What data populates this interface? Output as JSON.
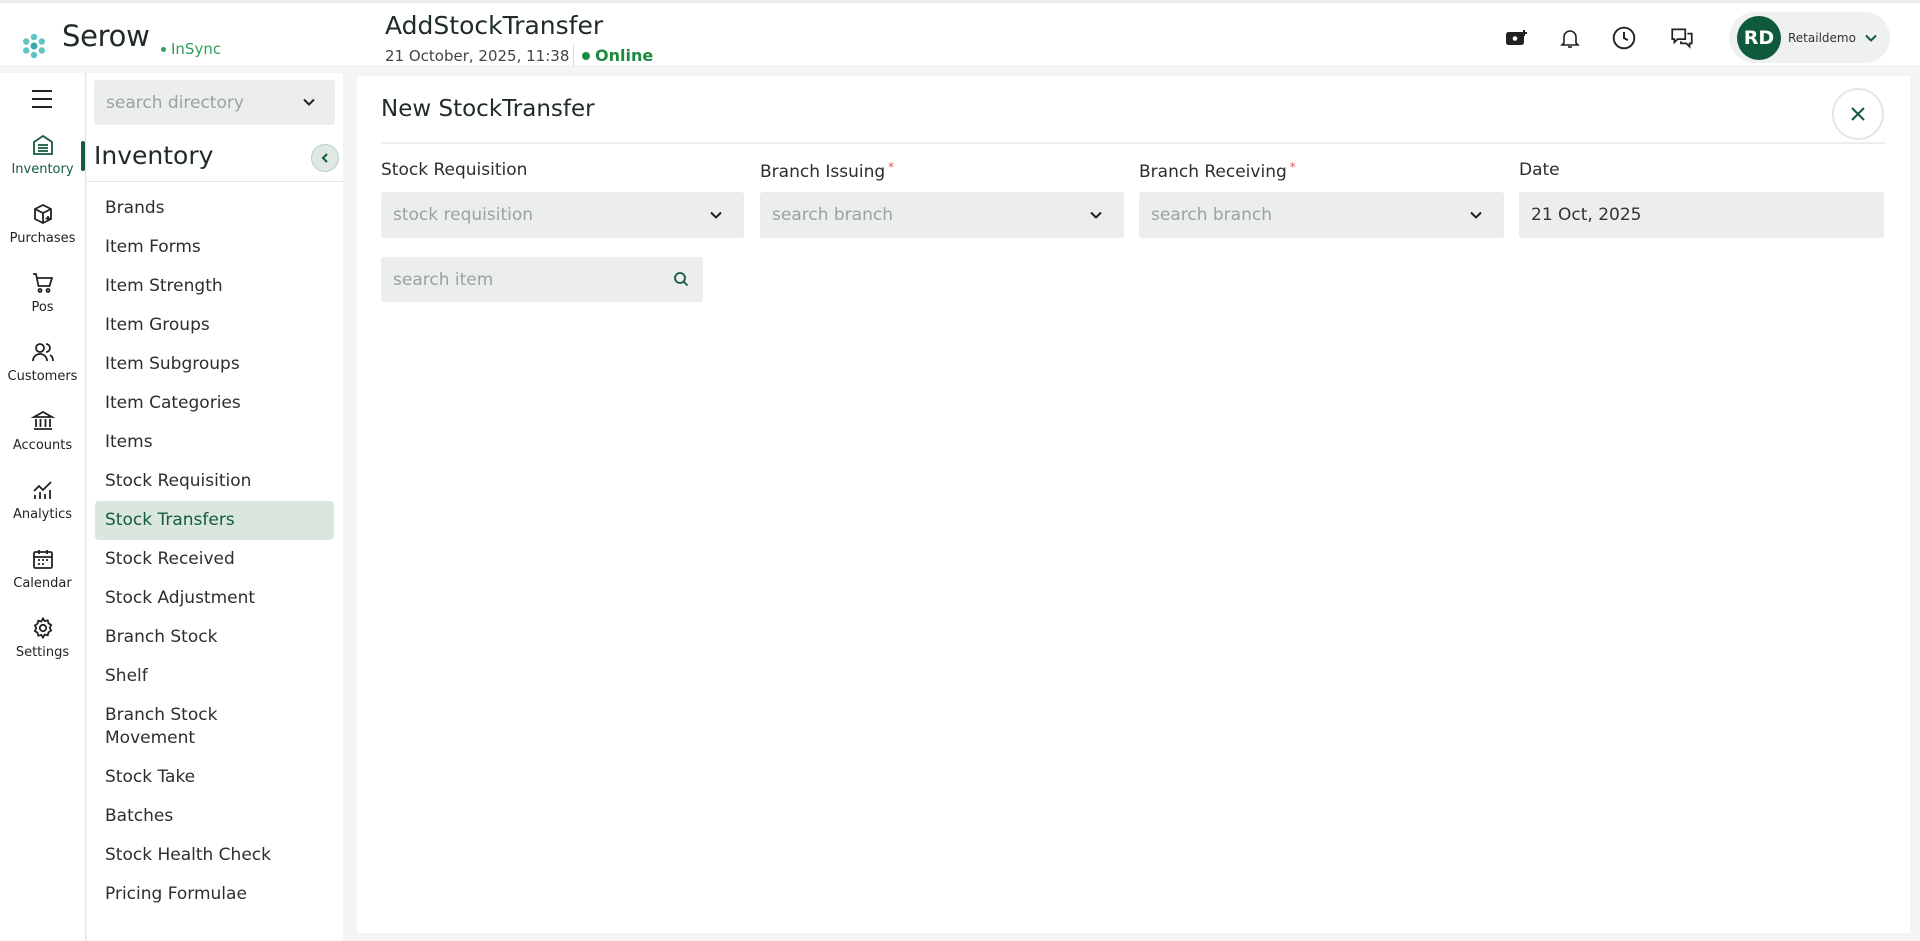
{
  "header": {
    "brand": "Serow",
    "sync_status": "InSync",
    "page_title": "AddStockTransfer",
    "datetime": "21 October, 2025, 11:38",
    "connection": "Online",
    "icons": [
      "add-cash-icon",
      "bell-icon",
      "clock-icon",
      "chat-icon"
    ],
    "user": {
      "initials": "RD",
      "name": "Retaildemo"
    }
  },
  "rail": {
    "items": [
      {
        "label": "Inventory",
        "icon": "inventory-icon",
        "active": true
      },
      {
        "label": "Purchases",
        "icon": "purchases-icon"
      },
      {
        "label": "Pos",
        "icon": "cart-icon"
      },
      {
        "label": "Customers",
        "icon": "customers-icon"
      },
      {
        "label": "Accounts",
        "icon": "bank-icon"
      },
      {
        "label": "Analytics",
        "icon": "analytics-icon"
      },
      {
        "label": "Calendar",
        "icon": "calendar-icon"
      },
      {
        "label": "Settings",
        "icon": "gear-icon"
      }
    ]
  },
  "subnav": {
    "search_placeholder": "search directory",
    "section_title": "Inventory",
    "items": [
      {
        "label": "Brands"
      },
      {
        "label": "Item Forms"
      },
      {
        "label": "Item Strength"
      },
      {
        "label": "Item Groups"
      },
      {
        "label": "Item Subgroups"
      },
      {
        "label": "Item Categories"
      },
      {
        "label": "Items"
      },
      {
        "label": "Stock Requisition"
      },
      {
        "label": "Stock Transfers",
        "active": true
      },
      {
        "label": "Stock Received"
      },
      {
        "label": "Stock Adjustment"
      },
      {
        "label": "Branch Stock"
      },
      {
        "label": "Shelf"
      },
      {
        "label": "Branch Stock Movement"
      },
      {
        "label": "Stock Take"
      },
      {
        "label": "Batches"
      },
      {
        "label": "Stock Health Check"
      },
      {
        "label": "Pricing Formulae"
      }
    ]
  },
  "form": {
    "title": "New StockTransfer",
    "fields": {
      "requisition": {
        "label": "Stock Requisition",
        "placeholder": "stock requisition",
        "required": false
      },
      "issuing": {
        "label": "Branch Issuing",
        "placeholder": "search branch",
        "required": true
      },
      "receiving": {
        "label": "Branch Receiving",
        "placeholder": "search branch",
        "required": true
      },
      "date": {
        "label": "Date",
        "value": "21 Oct, 2025"
      }
    },
    "required_mark": "*",
    "item_search_placeholder": "search item"
  },
  "colors": {
    "brand_green": "#155a3b",
    "online_green": "#1d8a3f",
    "active_bg": "#d9e7df",
    "input_bg": "#ebeeed",
    "required_red": "#e35b5b"
  }
}
